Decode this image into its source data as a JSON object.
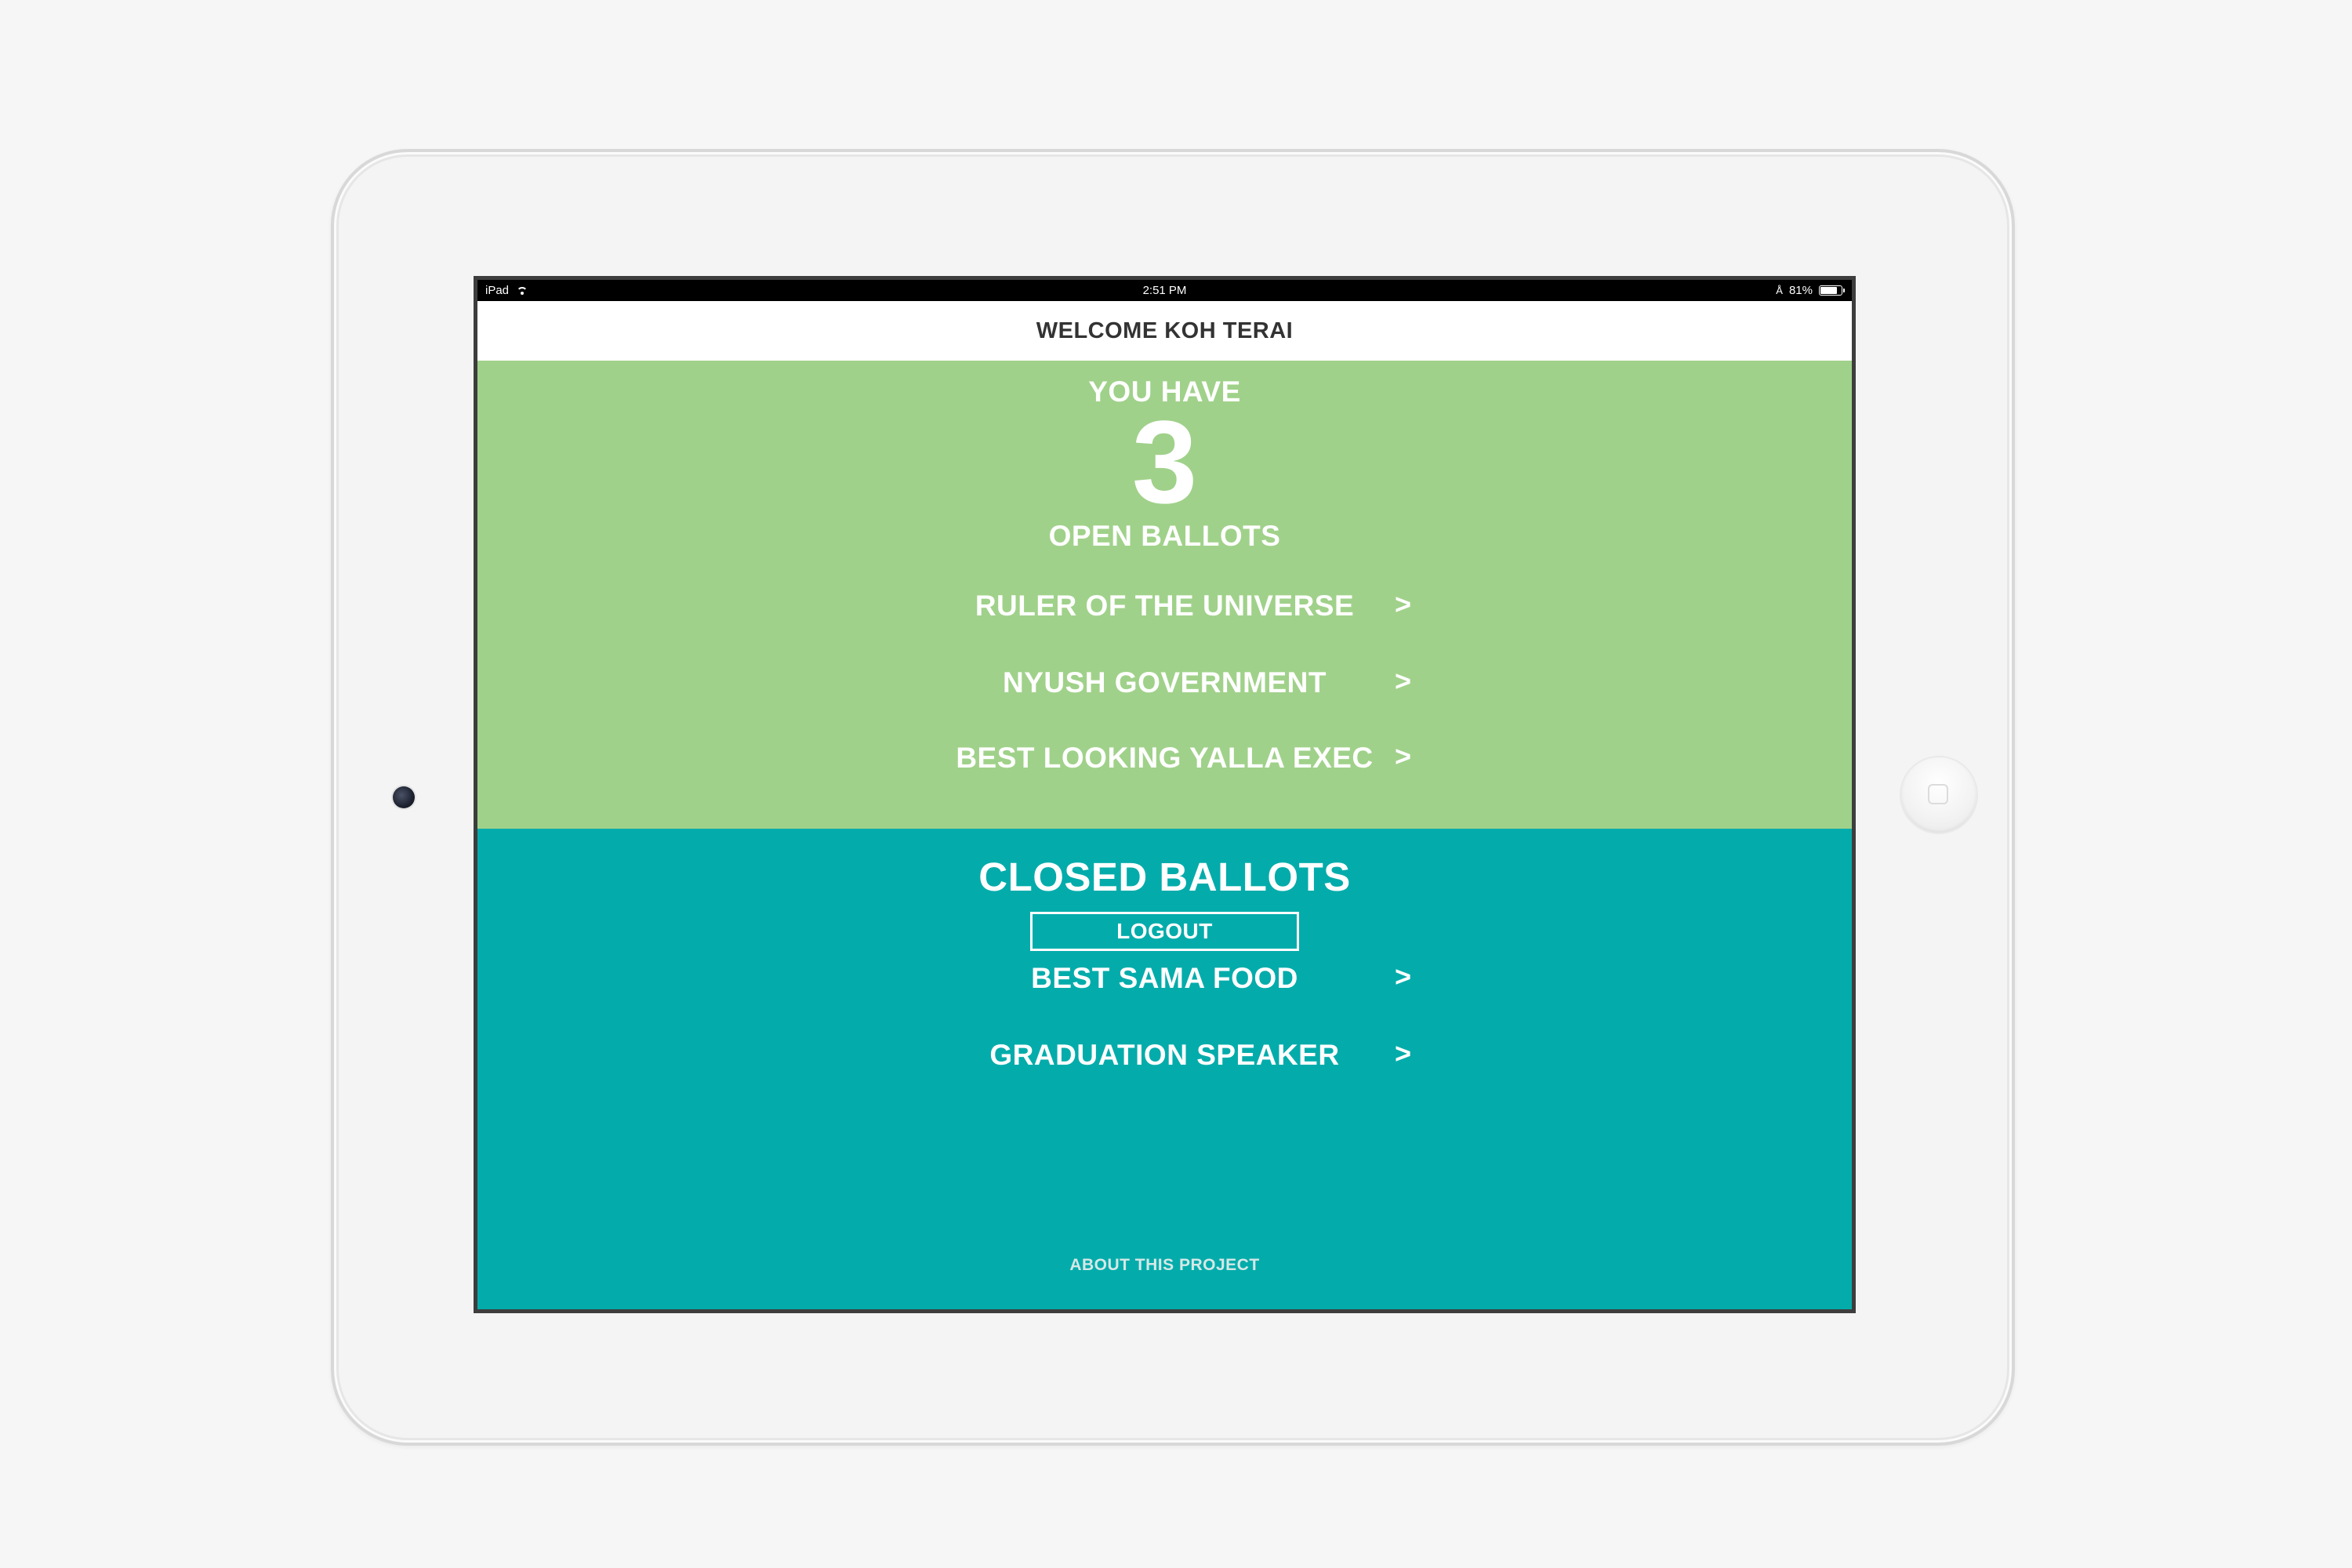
{
  "colors": {
    "background": "#f6f6f6",
    "open_section": "#a0d18a",
    "closed_section": "#03acab",
    "nav_text": "#333333"
  },
  "status_bar": {
    "device": "iPad",
    "time": "2:51 PM",
    "battery_text": "81%",
    "battery_level": 0.81
  },
  "header": {
    "title": "WELCOME KOH TERAI"
  },
  "open": {
    "intro": "YOU HAVE",
    "count": "3",
    "label": "OPEN BALLOTS",
    "ballots": [
      {
        "label": "RULER OF THE UNIVERSE",
        "chevron": ">"
      },
      {
        "label": "NYUSH GOVERNMENT",
        "chevron": ">"
      },
      {
        "label": "BEST LOOKING YALLA EXEC",
        "chevron": ">"
      }
    ]
  },
  "closed": {
    "title": "CLOSED BALLOTS",
    "ballots": [
      {
        "label": "BEST SAMA FOOD",
        "chevron": ">"
      },
      {
        "label": "GRADUATION SPEAKER",
        "chevron": ">"
      }
    ]
  },
  "footer": {
    "logout_label": "LOGOUT",
    "about_label": "ABOUT THIS PROJECT"
  },
  "icons": {
    "wifi": "wifi-icon",
    "bluetooth": "bluetooth-icon",
    "battery": "battery-icon",
    "chevron": "chevron-right-icon",
    "camera": "camera-icon",
    "home": "home-button-icon"
  }
}
